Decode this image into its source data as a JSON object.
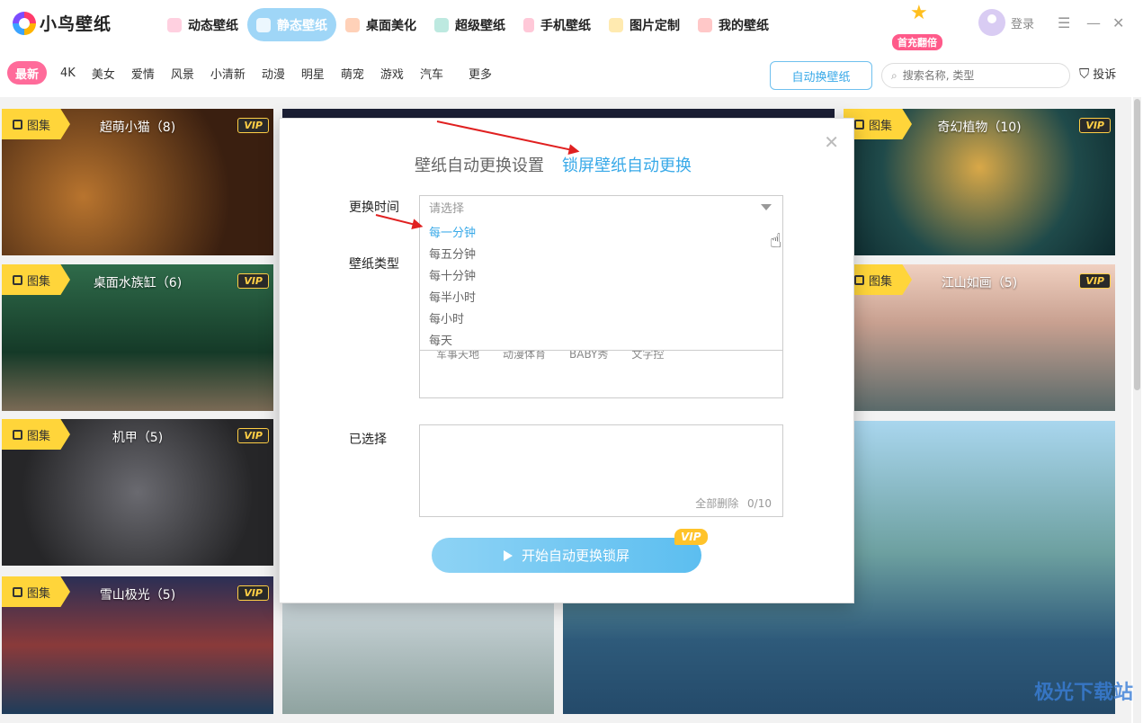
{
  "app": {
    "name": "小鸟壁纸"
  },
  "nav": [
    {
      "label": "动态壁纸",
      "color": "#ff7aa8"
    },
    {
      "label": "静态壁纸",
      "color": "#ffffff",
      "active": true
    },
    {
      "label": "桌面美化",
      "color": "#ff9a6b"
    },
    {
      "label": "超级壁纸",
      "color": "#3dc8b0"
    },
    {
      "label": "手机壁纸",
      "color": "#ff6b9a"
    },
    {
      "label": "图片定制",
      "color": "#ffc94a"
    },
    {
      "label": "我的壁纸",
      "color": "#ff7a7a"
    }
  ],
  "promo": {
    "text": "首充翻倍"
  },
  "login": {
    "label": "登录"
  },
  "categories": [
    "最新",
    "4K",
    "美女",
    "爱情",
    "风景",
    "小清新",
    "动漫",
    "明星",
    "萌宠",
    "游戏",
    "汽车",
    "更多"
  ],
  "toolbar": {
    "auto_switch": "自动换壁纸",
    "search_placeholder": "搜索名称, 类型",
    "report": "投诉"
  },
  "cards": [
    {
      "badge": "图集",
      "title": "超萌小猫（8)",
      "vip": "VIP"
    },
    {
      "badge": "图集",
      "title": "桌面水族缸（6)",
      "vip": "VIP"
    },
    {
      "badge": "图集",
      "title": "机甲（5)",
      "vip": "VIP"
    },
    {
      "badge": "图集",
      "title": "雪山极光（5)",
      "vip": "VIP"
    },
    {
      "badge": "图集",
      "title": "奇幻植物（10)",
      "vip": "VIP"
    },
    {
      "badge": "图集",
      "title": "江山如画（5)",
      "vip": "VIP"
    }
  ],
  "dialog": {
    "tab_wallpaper": "壁纸自动更换设置",
    "tab_lockscreen": "锁屏壁纸自动更换",
    "interval_label": "更换时间",
    "interval_placeholder": "请选择",
    "interval_options": [
      "每一分钟",
      "每五分钟",
      "每十分钟",
      "每半小时",
      "每小时",
      "每天"
    ],
    "type_label": "壁纸类型",
    "type_items": [
      "军事天地",
      "动漫体育",
      "BABY秀",
      "文字控"
    ],
    "selected_label": "已选择",
    "clear_all": "全部删除",
    "count": "0/10",
    "start_button": "开始自动更换锁屏",
    "start_vip": "VIP"
  },
  "watermark": "极光下载站"
}
